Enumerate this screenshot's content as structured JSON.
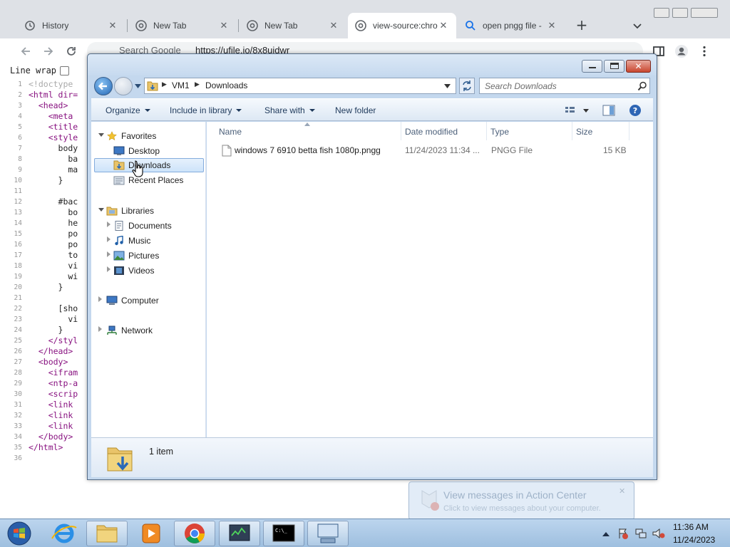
{
  "browser": {
    "tabs": [
      {
        "title": "History",
        "icon": "history-icon",
        "active": false
      },
      {
        "title": "New Tab",
        "icon": "chrome-icon",
        "active": false
      },
      {
        "title": "New Tab",
        "icon": "chrome-icon",
        "active": false
      },
      {
        "title": "view-source:chro",
        "icon": "chrome-icon",
        "active": true
      },
      {
        "title": "open pngg file -",
        "icon": "search-icon",
        "active": false
      }
    ],
    "new_tab_label": "+",
    "omnibox_placeholder": "Search Google",
    "omnibox_url": "https://ufile.io/8x8uidwr"
  },
  "view_source": {
    "line_wrap_label": "Line wrap",
    "line_wrap_checked": false,
    "lines": [
      {
        "n": "1",
        "text": "<!doctype",
        "kind": "cmt"
      },
      {
        "n": "2",
        "text": "<html dir=",
        "kind": "tag"
      },
      {
        "n": "3",
        "text": "  <head>",
        "kind": "tag"
      },
      {
        "n": "4",
        "text": "    <meta",
        "kind": "tag"
      },
      {
        "n": "5",
        "text": "    <title",
        "kind": "tag"
      },
      {
        "n": "6",
        "text": "    <style",
        "kind": "tag"
      },
      {
        "n": "7",
        "text": "      body",
        "kind": "plain"
      },
      {
        "n": "8",
        "text": "        ba",
        "kind": "plain"
      },
      {
        "n": "9",
        "text": "        ma",
        "kind": "plain"
      },
      {
        "n": "10",
        "text": "      }",
        "kind": "plain"
      },
      {
        "n": "11",
        "text": "",
        "kind": "plain"
      },
      {
        "n": "12",
        "text": "      #bac",
        "kind": "plain"
      },
      {
        "n": "13",
        "text": "        bo",
        "kind": "plain"
      },
      {
        "n": "14",
        "text": "        he",
        "kind": "plain"
      },
      {
        "n": "15",
        "text": "        po",
        "kind": "plain"
      },
      {
        "n": "16",
        "text": "        po",
        "kind": "plain"
      },
      {
        "n": "17",
        "text": "        to",
        "kind": "plain"
      },
      {
        "n": "18",
        "text": "        vi",
        "kind": "plain"
      },
      {
        "n": "19",
        "text": "        wi",
        "kind": "plain"
      },
      {
        "n": "20",
        "text": "      }",
        "kind": "plain"
      },
      {
        "n": "21",
        "text": "",
        "kind": "plain"
      },
      {
        "n": "22",
        "text": "      [sho",
        "kind": "plain"
      },
      {
        "n": "23",
        "text": "        vi",
        "kind": "plain"
      },
      {
        "n": "24",
        "text": "      }",
        "kind": "plain"
      },
      {
        "n": "25",
        "text": "    </styl",
        "kind": "tag"
      },
      {
        "n": "26",
        "text": "  </head>",
        "kind": "tag"
      },
      {
        "n": "27",
        "text": "  <body>",
        "kind": "tag"
      },
      {
        "n": "28",
        "text": "    <ifram",
        "kind": "tag"
      },
      {
        "n": "29",
        "text": "    <ntp-a",
        "kind": "tag"
      },
      {
        "n": "30",
        "text": "    <scrip",
        "kind": "tag"
      },
      {
        "n": "31",
        "text": "    <link",
        "kind": "tag"
      },
      {
        "n": "32",
        "text": "    <link",
        "kind": "tag"
      },
      {
        "n": "33",
        "text": "    <link",
        "kind": "tag"
      },
      {
        "n": "34",
        "text": "  </body>",
        "kind": "tag"
      },
      {
        "n": "35",
        "text": "</html>",
        "kind": "tag"
      },
      {
        "n": "36",
        "text": "",
        "kind": "plain"
      }
    ]
  },
  "explorer": {
    "breadcrumb": [
      "VM1",
      "Downloads"
    ],
    "search_placeholder": "Search Downloads",
    "commands": {
      "organize": "Organize",
      "include": "Include in library",
      "share": "Share with",
      "new_folder": "New folder"
    },
    "nav": {
      "favorites": "Favorites",
      "desktop": "Desktop",
      "downloads": "Downloads",
      "recent": "Recent Places",
      "libraries": "Libraries",
      "documents": "Documents",
      "music": "Music",
      "pictures": "Pictures",
      "videos": "Videos",
      "computer": "Computer",
      "network": "Network"
    },
    "columns": {
      "name": "Name",
      "date": "Date modified",
      "type": "Type",
      "size": "Size"
    },
    "files": [
      {
        "name": "windows 7 6910 betta fish 1080p.pngg",
        "date": "11/24/2023 11:34 ...",
        "type": "PNGG File",
        "size": "15 KB"
      }
    ],
    "details_count": "1 item"
  },
  "action_center": {
    "title": "View messages in Action Center",
    "subtitle": "Click to view messages about your computer."
  },
  "taskbar": {
    "time": "11:36 AM",
    "date": "11/24/2023"
  },
  "colors": {
    "accent": "#1a73e8",
    "explorer_frame": "#c4d8ee",
    "taskbar": "#a9c7e6"
  }
}
